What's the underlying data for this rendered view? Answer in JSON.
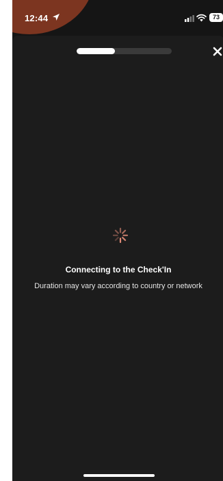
{
  "status_bar": {
    "time": "12:44",
    "battery": "73",
    "location_icon": "location-arrow-icon",
    "signal_icon": "cellular-signal-icon",
    "wifi_icon": "wifi-icon"
  },
  "header": {
    "progress_fraction": 0.4,
    "close_icon": "close-icon"
  },
  "loading": {
    "spinner_icon": "spinner-icon",
    "title": "Connecting to the Check'In",
    "subtitle": "Duration may vary according to country or network"
  },
  "colors": {
    "background": "#151515",
    "sheet": "#1c1c1c",
    "accent_blob": "#7c3520",
    "spinner": "#e08a76",
    "text": "#ffffff"
  }
}
